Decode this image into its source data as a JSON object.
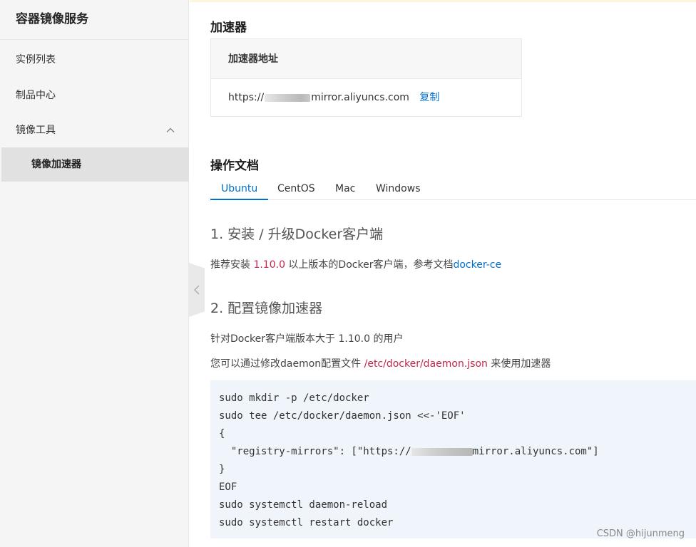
{
  "sidebar": {
    "title": "容器镜像服务",
    "items": [
      {
        "label": "实例列表"
      },
      {
        "label": "制品中心"
      },
      {
        "label": "镜像工具"
      },
      {
        "label": "镜像加速器"
      }
    ]
  },
  "accelerator": {
    "section_title": "加速器",
    "table_header": "加速器地址",
    "url_prefix": "https://",
    "url_suffix": "mirror.aliyuncs.com",
    "copy_label": "复制"
  },
  "docs": {
    "section_title": "操作文档",
    "tabs": [
      {
        "label": "Ubuntu",
        "active": true
      },
      {
        "label": "CentOS",
        "active": false
      },
      {
        "label": "Mac",
        "active": false
      },
      {
        "label": "Windows",
        "active": false
      }
    ],
    "step1_title": "1. 安装 / 升级Docker客户端",
    "step1_text_a": "推荐安装 ",
    "step1_version": "1.10.0",
    "step1_text_b": " 以上版本的Docker客户端，参考文档",
    "step1_link": "docker-ce",
    "step2_title": "2. 配置镜像加速器",
    "step2_text1": "针对Docker客户端版本大于 1.10.0 的用户",
    "step2_text2_a": "您可以通过修改daemon配置文件 ",
    "step2_path": "/etc/docker/daemon.json",
    "step2_text2_b": " 来使用加速器",
    "code_lines": {
      "l1": "sudo mkdir -p /etc/docker",
      "l2": "sudo tee /etc/docker/daemon.json <<-'EOF'",
      "l3": "{",
      "l4_a": "  \"registry-mirrors\": [\"https://",
      "l4_b": "mirror.aliyuncs.com\"]",
      "l5": "}",
      "l6": "EOF",
      "l7": "sudo systemctl daemon-reload",
      "l8": "sudo systemctl restart docker"
    }
  },
  "watermark": "CSDN @hijunmeng",
  "colors": {
    "accent": "#0070cc",
    "highlight": "#c7254e",
    "sidebar_bg": "#f5f5f5",
    "code_bg": "#f0f5fb"
  }
}
